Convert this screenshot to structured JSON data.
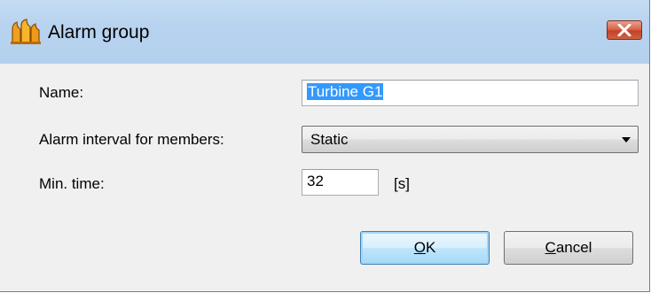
{
  "window": {
    "title": "Alarm group",
    "title_icon": "alarm-group-icon",
    "close_icon": "close-icon"
  },
  "form": {
    "name_label": "Name:",
    "name_value": "Turbine G1",
    "interval_label": "Alarm interval for members:",
    "interval_value": "Static",
    "min_time_label": "Min. time:",
    "min_time_value": "32",
    "min_time_unit": "[s]"
  },
  "buttons": {
    "ok_mnemonic": "O",
    "ok_rest": "K",
    "cancel_mnemonic": "C",
    "cancel_rest": "ancel"
  },
  "colors": {
    "titlebar": "#b9d4f0",
    "selection": "#3399ff",
    "close_button": "#c3432a"
  }
}
